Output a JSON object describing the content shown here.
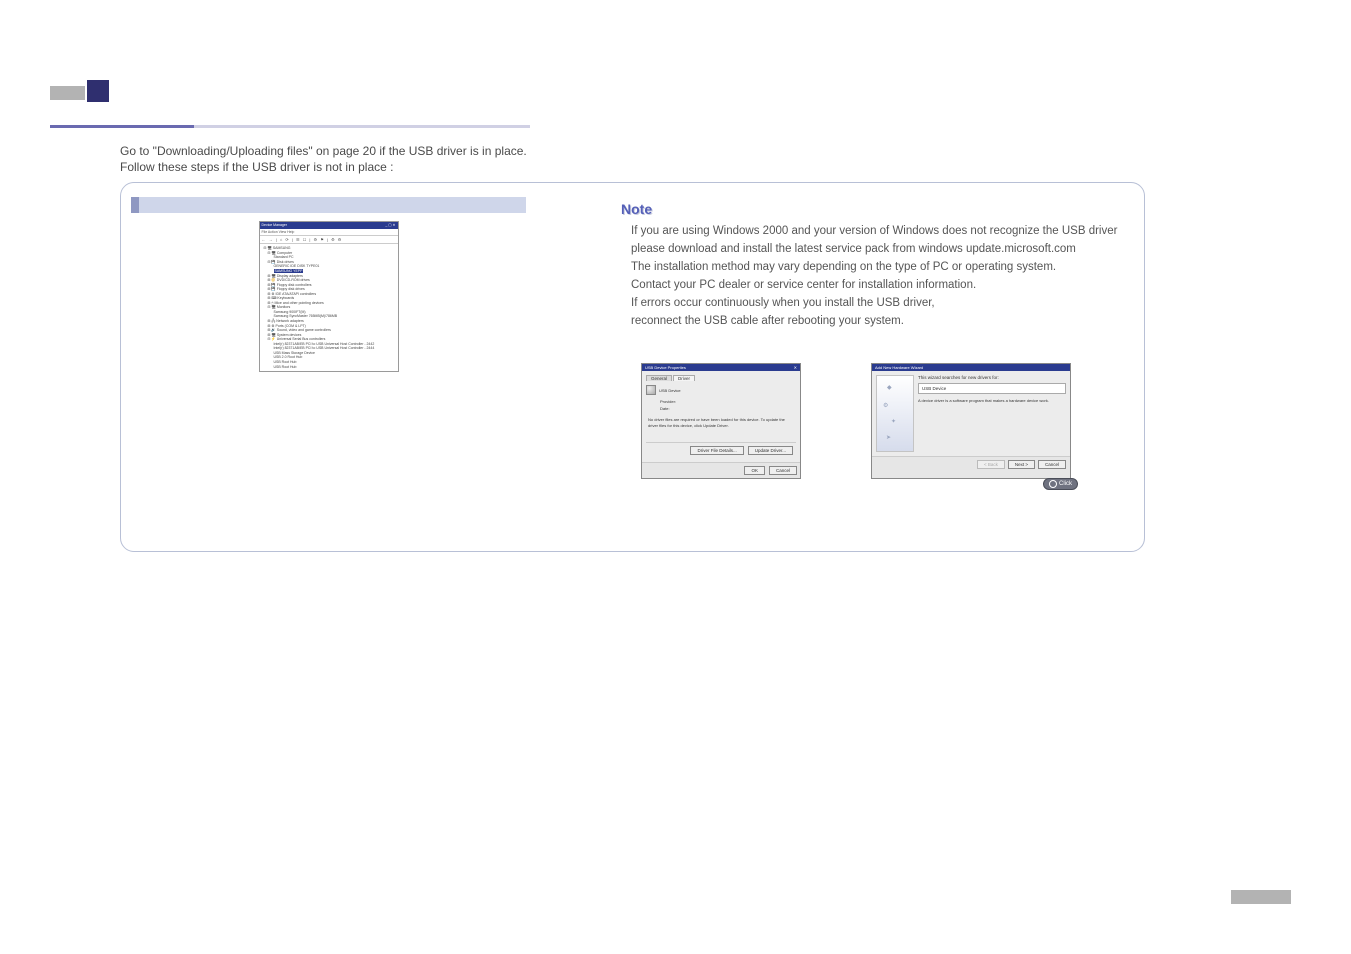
{
  "intro": {
    "line1": "Go to \"Downloading/Uploading files\" on page 20 if the USB driver is in place.",
    "line2": "Follow these steps if the USB driver is not in place :"
  },
  "note": {
    "title": "Note",
    "l1": "If you are using Windows 2000 and your version of Windows does not recognize the USB driver",
    "l2": "please download and install the latest service pack from windows update.microsoft.com",
    "l3": "The installation method may vary depending on the type of PC or operating system.",
    "l4": "Contact your PC dealer or service center for installation information.",
    "l5": "If errors occur continuously when you install the USB driver,",
    "l6": "reconnect the USB cable after rebooting your system."
  },
  "deviceManager": {
    "title": "Device Manager",
    "menu": "File   Action   View   Help",
    "toolbar": "← →  | ⌂ ⟳ | ☰ ☐ | ⚙ ⚑ | ⚙ ⚙",
    "tree": [
      {
        "lvl": 0,
        "text": "⊟ 🖥 SAMSUNG"
      },
      {
        "lvl": 1,
        "text": "⊟ 🖥 Computer"
      },
      {
        "lvl": 2,
        "text": "Standard PC"
      },
      {
        "lvl": 1,
        "text": "⊟ 💾 Disk drives"
      },
      {
        "lvl": 2,
        "text": "GENERIC IDE DISK TYPE01"
      },
      {
        "lvl": 2,
        "sel": true,
        "text": "SAMSUNG YEPP"
      },
      {
        "lvl": 1,
        "text": "⊞ 🖥 Display adapters"
      },
      {
        "lvl": 1,
        "text": "⊞ 📀 DVD/CD-ROM drives"
      },
      {
        "lvl": 1,
        "text": "⊞ 💾 Floppy disk controllers"
      },
      {
        "lvl": 1,
        "text": "⊞ 💾 Floppy disk drives"
      },
      {
        "lvl": 1,
        "text": "⊞ ⚙ IDE ATA/ATAPI controllers"
      },
      {
        "lvl": 1,
        "text": "⊞ ⌨ Keyboards"
      },
      {
        "lvl": 1,
        "text": "⊞ 🖱 Mice and other pointing devices"
      },
      {
        "lvl": 1,
        "text": "⊟ 🖥 Monitors"
      },
      {
        "lvl": 2,
        "text": "Samsung 900IFT(M)"
      },
      {
        "lvl": 2,
        "text": "Samsung SyncMaster 765MB(M)/786MB"
      },
      {
        "lvl": 1,
        "text": "⊞ 🖧 Network adapters"
      },
      {
        "lvl": 1,
        "text": "⊞ ⚙ Ports (COM & LPT)"
      },
      {
        "lvl": 1,
        "text": "⊞ 🔊 Sound, video and game controllers"
      },
      {
        "lvl": 1,
        "text": "⊞ 🖥 System devices"
      },
      {
        "lvl": 1,
        "text": "⊟ ⚡ Universal Serial Bus controllers"
      },
      {
        "lvl": 2,
        "text": "Intel(r) 82371AB/EB PCI to USB Universal Host Controller - 2442"
      },
      {
        "lvl": 2,
        "text": "Intel(r) 82371AB/EB PCI to USB Universal Host Controller - 2444"
      },
      {
        "lvl": 2,
        "text": "USB Mass Storage Device"
      },
      {
        "lvl": 2,
        "text": "USB 2.0 Root Hub"
      },
      {
        "lvl": 2,
        "text": "USB Root Hub"
      },
      {
        "lvl": 2,
        "text": "USB Root Hub"
      }
    ]
  },
  "usbDialog": {
    "title": "USB Device Properties",
    "tabs": {
      "general": "General",
      "driver": "Driver"
    },
    "deviceName": "USB Device",
    "provider": "Provider:",
    "date": "Date:",
    "message": "No driver files are required or have been loaded for this device. To update the driver files for this device, click Update Driver.",
    "buttons": {
      "details": "Driver File Details...",
      "update": "Update Driver...",
      "ok": "OK",
      "cancel": "Cancel"
    }
  },
  "wizard": {
    "title": "Add New Hardware Wizard",
    "heading": "This wizard searches for new drivers for:",
    "device": "USB Device",
    "text": "A device driver is a software program that makes a hardware device work.",
    "buttons": {
      "back": "< Back",
      "next": "Next >",
      "cancel": "Cancel"
    },
    "click": "Click"
  }
}
